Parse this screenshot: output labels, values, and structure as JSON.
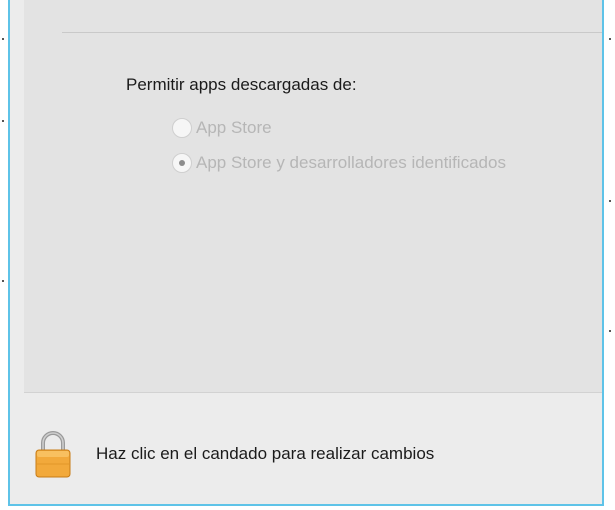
{
  "security": {
    "allow_heading": "Permitir apps descargadas de:",
    "options": [
      {
        "label": "App Store",
        "selected": false,
        "enabled": false
      },
      {
        "label": "App Store y desarrolladores identificados",
        "selected": true,
        "enabled": false
      }
    ]
  },
  "footer": {
    "lock_icon": "lock-icon",
    "lock_text": "Haz clic en el candado para realizar cambios"
  },
  "colors": {
    "frame_border": "#5ec3e8",
    "panel_bg": "#e3e3e3",
    "window_bg": "#ececec",
    "disabled_text": "#b6b6b6",
    "lock_body": "#f2a93b"
  }
}
